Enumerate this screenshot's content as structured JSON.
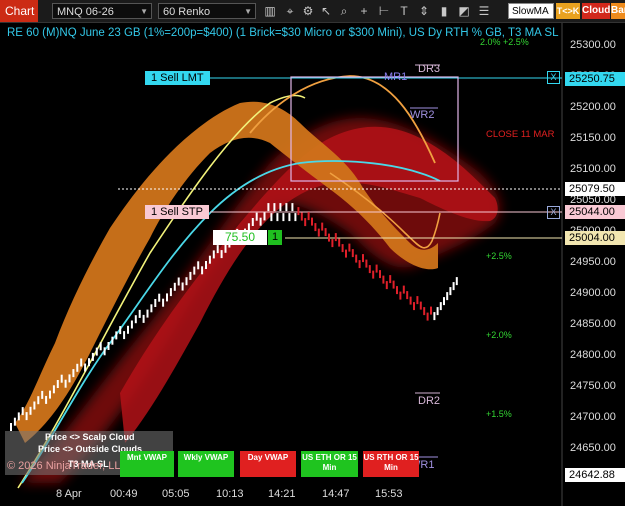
{
  "toolbar": {
    "chart_tab": "Chart",
    "instrument": "MNQ 06-26",
    "bar_type": "60 Renko",
    "strategy_select": "SlowMA",
    "btn_tck": "T<>K",
    "btn_cloud": "Cloud",
    "btn_bar": "Bar",
    "icons": [
      "data-series-icon",
      "crosshair-icon",
      "pointer-icon",
      "zoom-icon",
      "magnify-icon",
      "properties-icon",
      "add-icon",
      "measure-icon",
      "text-icon",
      "scale-icon",
      "bar-icon",
      "shapes-icon"
    ]
  },
  "header": {
    "title": "RE 60 (M)NQ June 23 GB (1%=200p=$400) (1 Brick=$30 Micro or $300 Mini), US Dy RTH % GB, T3 MA SL",
    "pct_top": "2.0%  +2.5%",
    "price_top": "25300.00"
  },
  "price_axis": {
    "ticks": [
      "25300.00",
      "25250.00",
      "25200.00",
      "25150.00",
      "25100.00",
      "25050.00",
      "25000.00",
      "24950.00",
      "24900.00",
      "24850.00",
      "24800.00",
      "24750.00",
      "24700.00",
      "24650.00"
    ],
    "labels": [
      {
        "text": "25250.75",
        "bg": "#33d8f0",
        "fg": "#000"
      },
      {
        "text": "25079.50",
        "bg": "#ffffff",
        "fg": "#000"
      },
      {
        "text": "25044.00",
        "bg": "#f9c9d4",
        "fg": "#000"
      },
      {
        "text": "25004.00",
        "bg": "#f2e6b0",
        "fg": "#000"
      },
      {
        "text": "24642.88",
        "bg": "#ffffff",
        "fg": "#000"
      }
    ]
  },
  "orders": {
    "sell_lmt": "1 Sell LMT",
    "sell_stp": "1 Sell STP",
    "position_value": "75.50",
    "position_qty": "1",
    "close_x": "X"
  },
  "annotations": {
    "dr3": "DR3",
    "mr1": "MR1",
    "wr2": "WR2",
    "close_label": "CLOSE 11 MAR",
    "pct_25": "+2.5%",
    "pct_20": "+2.0%",
    "pct_15": "+1.5%",
    "dr2": "DR2",
    "wr1": "WR1"
  },
  "time_axis": [
    "8 Apr",
    "00:49",
    "05:05",
    "10:13",
    "14:21",
    "14:47",
    "15:53"
  ],
  "legend": {
    "row1": "Price <> Scalp Cloud",
    "row2": "Price <> Outside Clouds",
    "row3": "T3 MA SL",
    "copyright": "© 2026 NinjaTrader, LLC"
  },
  "vwap_buttons": [
    {
      "text": "Mnt VWAP",
      "color": "#1fc41f"
    },
    {
      "text": "Wkly VWAP",
      "color": "#1fc41f"
    },
    {
      "text": "Day VWAP",
      "color": "#e02020"
    },
    {
      "text": "US ETH OR 15 Min",
      "color": "#1fc41f"
    },
    {
      "text": "US RTH OR 15 Min",
      "color": "#e02020"
    }
  ],
  "colors": {
    "candle_up": "#ffffff",
    "candle_down": "#e0202a",
    "cloud_orange": "#e07a17",
    "cloud_red": "#8a0a10",
    "ma_yellow": "#f2f27a",
    "ma_cyan": "#4ad8e8",
    "ma_orange": "#f0a040",
    "accent_tab": "#cc2b14"
  }
}
